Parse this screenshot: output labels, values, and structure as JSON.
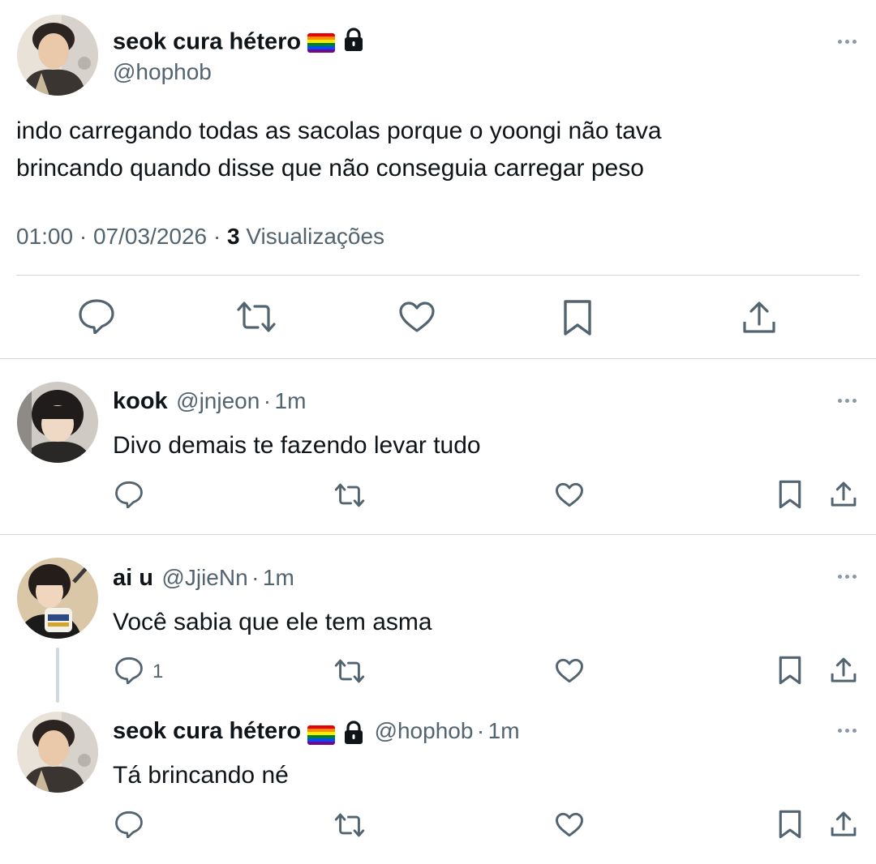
{
  "main_tweet": {
    "display_name": "seok cura hétero",
    "handle": "@hophob",
    "text_line1": "indo carregando todas as sacolas porque o yoongi não tava",
    "text_line2": "brincando quando disse que não conseguia carregar peso",
    "time": "01:00",
    "date": "07/03/2026",
    "views_count": "3",
    "views_label": "Visualizações",
    "separator": "·"
  },
  "replies": [
    {
      "display_name": "kook",
      "handle": "@jnjeon",
      "time": "1m",
      "text": "Divo demais te fazendo levar tudo",
      "reply_count": ""
    },
    {
      "display_name": "ai u",
      "handle": "@JjieNn",
      "time": "1m",
      "text": "Você sabia que ele tem asma",
      "reply_count": "1"
    },
    {
      "display_name": "seok cura hétero",
      "handle": "@hophob",
      "time": "1m",
      "text": "Tá brincando né",
      "reply_count": ""
    }
  ],
  "icons": {
    "reply": "speech-bubble-icon",
    "retweet": "retweet-arrows-icon",
    "like": "heart-icon",
    "bookmark": "bookmark-icon",
    "share": "share-upload-icon",
    "more": "three-dots-icon",
    "lock": "lock-icon",
    "flag": "rainbow-flag-icon"
  },
  "colors": {
    "text_primary": "#0f1419",
    "text_secondary": "#536471",
    "divider": "#cfd9de"
  }
}
